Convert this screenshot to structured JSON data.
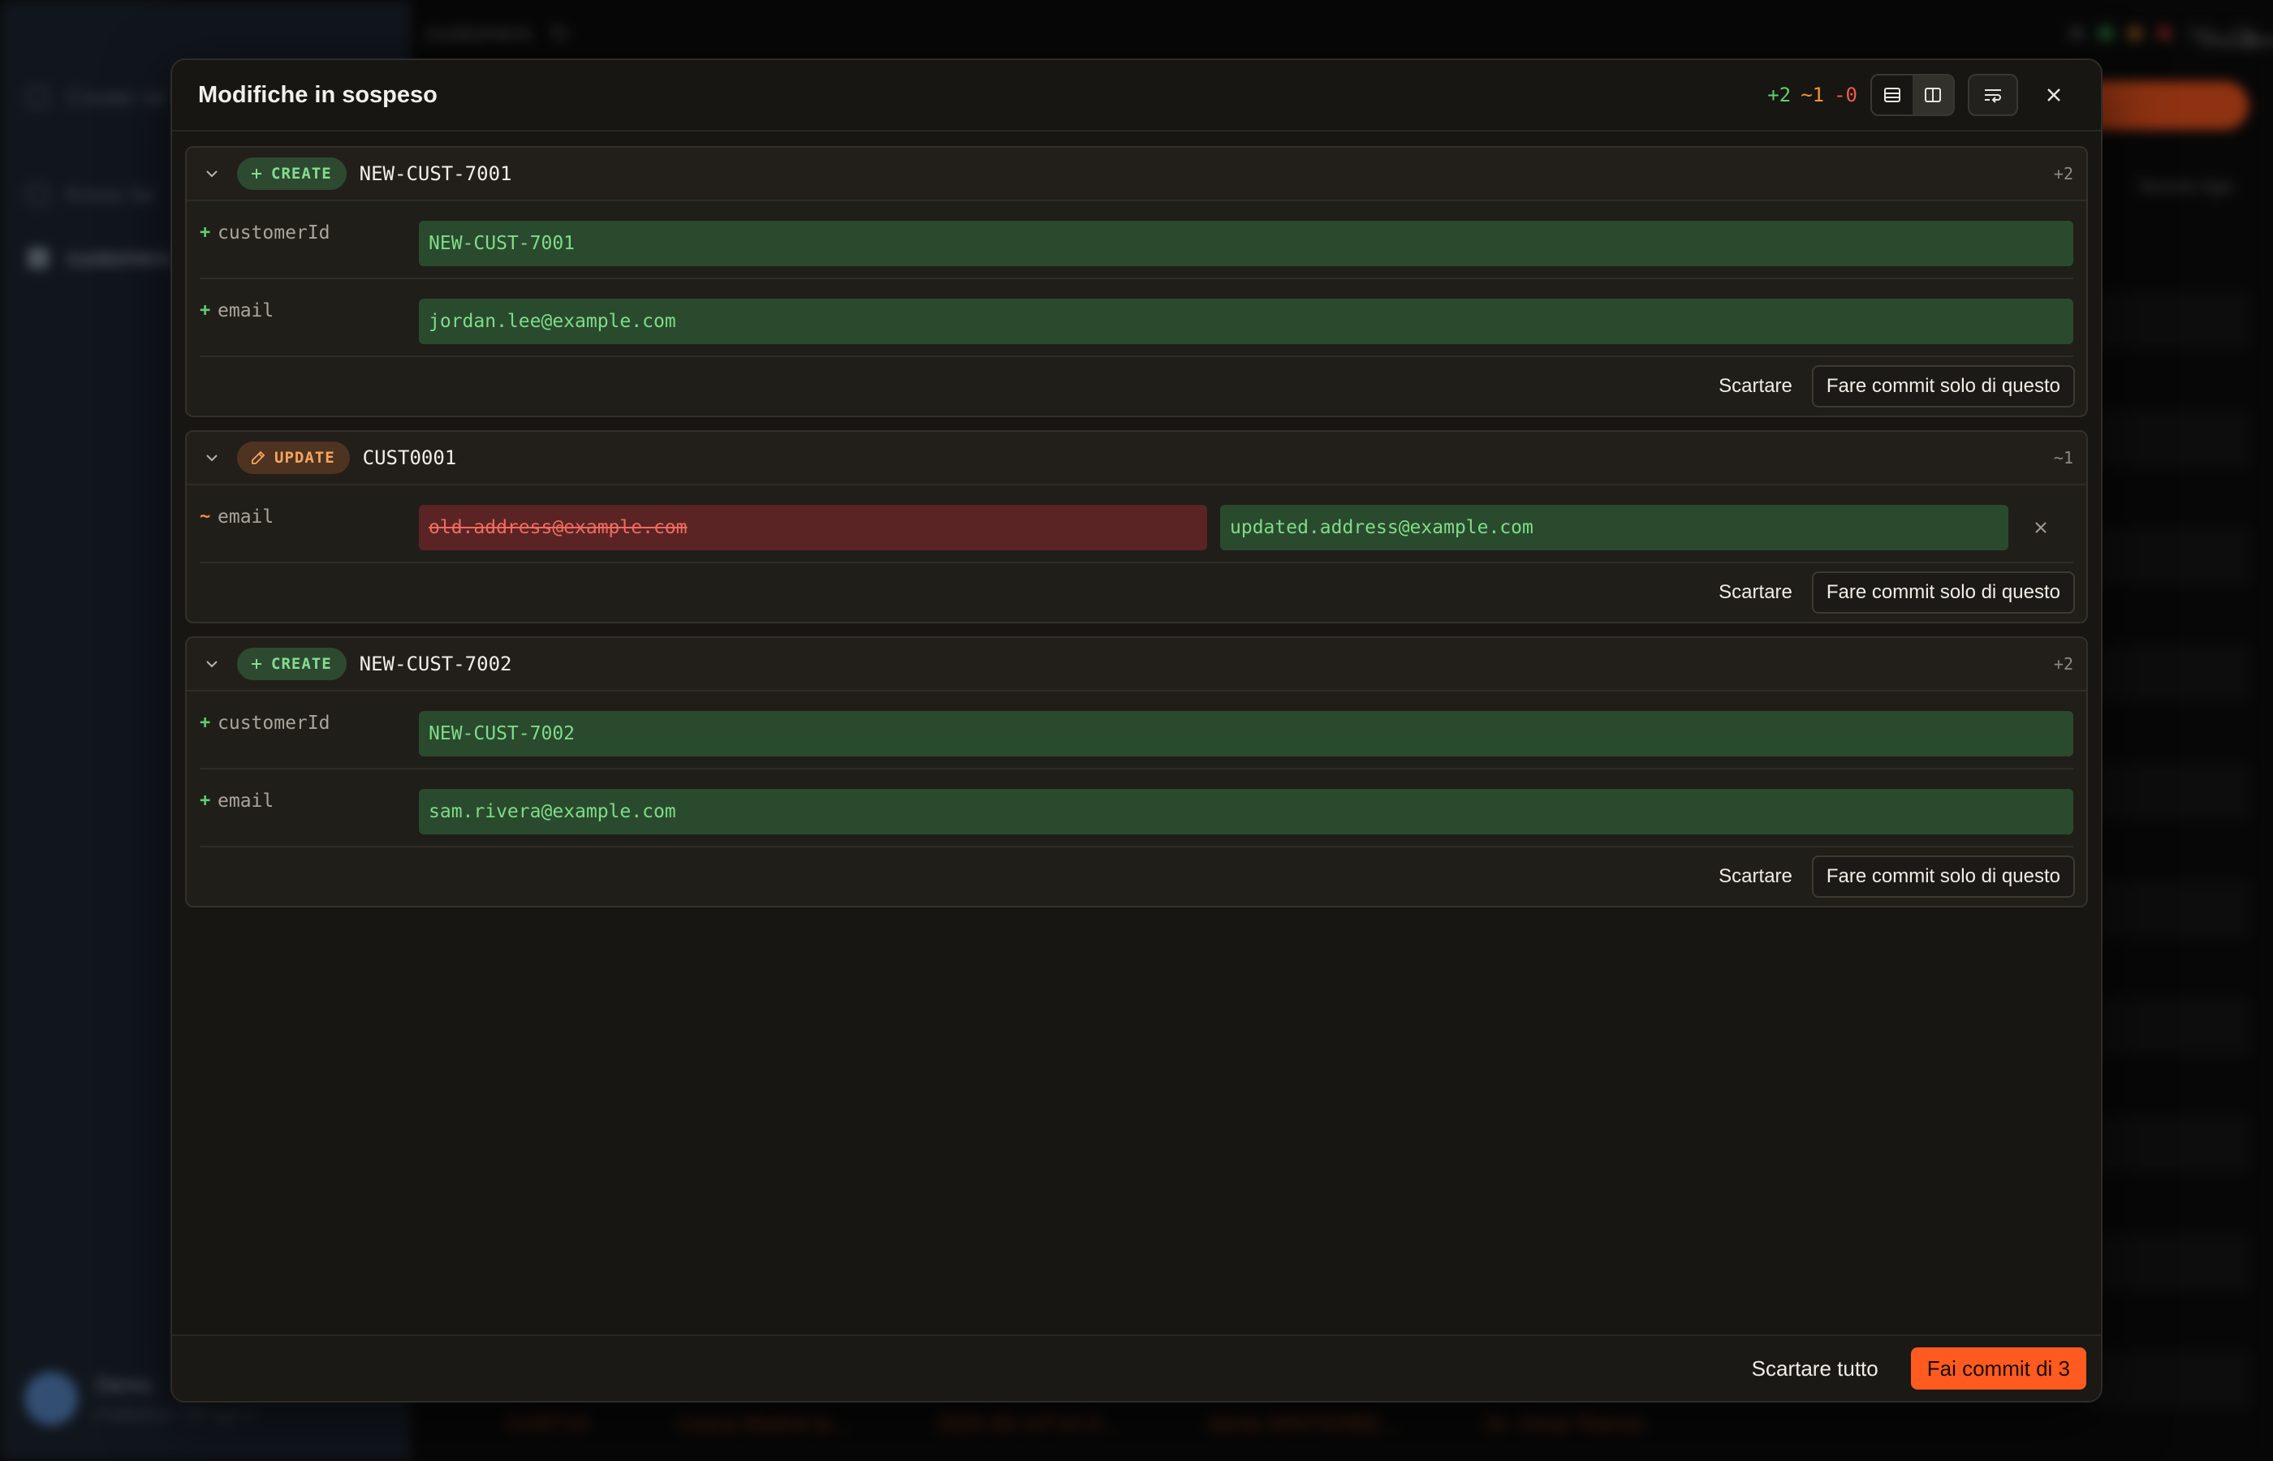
{
  "colors": {
    "accent": "#ff5a1f",
    "added": "#5fcf6e",
    "modified": "#f3923d",
    "deleted": "#ef5b4c",
    "modal_bg": "#171613"
  },
  "background": {
    "sidebar_items": [
      "Create ne",
      "Know fai",
      "customers"
    ],
    "user_name": "Demo",
    "user_sub": "Publisher • 3d ago 2",
    "topbar_title": "customers",
    "topbar_chips": [
      "Visuali",
      "Tornà"
    ],
    "right_button": "Nuova riga",
    "bottom_row": [
      "CUST10",
      "Cosca Madrid la...",
      "2025-06-14T10:3...",
      "Jamie.WINTERBE...",
      "Dr. Omar Ramos"
    ]
  },
  "modal": {
    "title": "Modifiche in sospeso",
    "counts": {
      "added": "+2",
      "modified": "~1",
      "deleted": "-0"
    },
    "icons": {
      "view_unified": "rows-icon",
      "view_split": "columns-icon",
      "wrap": "wrap-text-icon",
      "close": "close-icon"
    }
  },
  "changes": [
    {
      "type": "CREATE",
      "id": "NEW-CUST-7001",
      "count": "+2",
      "fields": [
        {
          "marker": "+",
          "name": "customerId",
          "new": "NEW-CUST-7001"
        },
        {
          "marker": "+",
          "name": "email",
          "new": "jordan.lee@example.com"
        }
      ],
      "discard_label": "Scartare",
      "commit_label": "Fare commit solo di questo"
    },
    {
      "type": "UPDATE",
      "id": "CUST0001",
      "count": "~1",
      "fields": [
        {
          "marker": "~",
          "name": "email",
          "old": "old.address@example.com",
          "new": "updated.address@example.com"
        }
      ],
      "discard_label": "Scartare",
      "commit_label": "Fare commit solo di questo"
    },
    {
      "type": "CREATE",
      "id": "NEW-CUST-7002",
      "count": "+2",
      "fields": [
        {
          "marker": "+",
          "name": "customerId",
          "new": "NEW-CUST-7002"
        },
        {
          "marker": "+",
          "name": "email",
          "new": "sam.rivera@example.com"
        }
      ],
      "discard_label": "Scartare",
      "commit_label": "Fare commit solo di questo"
    }
  ],
  "footer": {
    "discard_all_label": "Scartare tutto",
    "commit_label": "Fai commit di 3"
  }
}
